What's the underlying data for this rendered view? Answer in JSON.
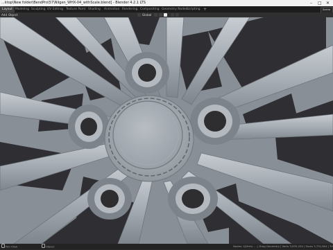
{
  "window": {
    "title": "...ktop\\New folder\\BendPro\\57\\Nilgen_WHX-04_withScale.blend] - Blender 4.2.1 LTS",
    "controls": {
      "minimize": "–",
      "maximize": "□",
      "close": "✕"
    }
  },
  "workspace_tabs": [
    {
      "label": "Layout",
      "active": true
    },
    {
      "label": "Modeling",
      "active": false
    },
    {
      "label": "Sculpting",
      "active": false
    },
    {
      "label": "UV Editing",
      "active": false
    },
    {
      "label": "Texture Paint",
      "active": false
    },
    {
      "label": "Shading",
      "active": false
    },
    {
      "label": "Animation",
      "active": false
    },
    {
      "label": "Rendering",
      "active": false
    },
    {
      "label": "Compositing",
      "active": false
    },
    {
      "label": "Geometry Nodes",
      "active": false
    },
    {
      "label": "Scripting",
      "active": false
    }
  ],
  "add_workspace": "+",
  "scene_selector": "Scene",
  "header": {
    "add_label": "Add",
    "object_label": "Object",
    "orientation": "Global"
  },
  "status_bar": {
    "left_text": "Pan View",
    "object_text": "Object",
    "right_text": "Nodes: 4|Verts: ... | Drag Geometry | Verts 3,635,434 | Faces 3,731,804 | Tris 10,7..."
  },
  "icons": {
    "cursor": "mouse-icon",
    "pivot": "pivot-icon",
    "snap": "magnet-icon",
    "proportional": "proportional-icon"
  },
  "colors": {
    "viewport_bg": "#4b4b4d",
    "wheel_base": "#8d949b",
    "wheel_light": "#c4cad0",
    "hole_dark": "#2e2e31",
    "titlebar_bg": "#f3f3f3",
    "workspace_bg": "#1d1d1d"
  }
}
